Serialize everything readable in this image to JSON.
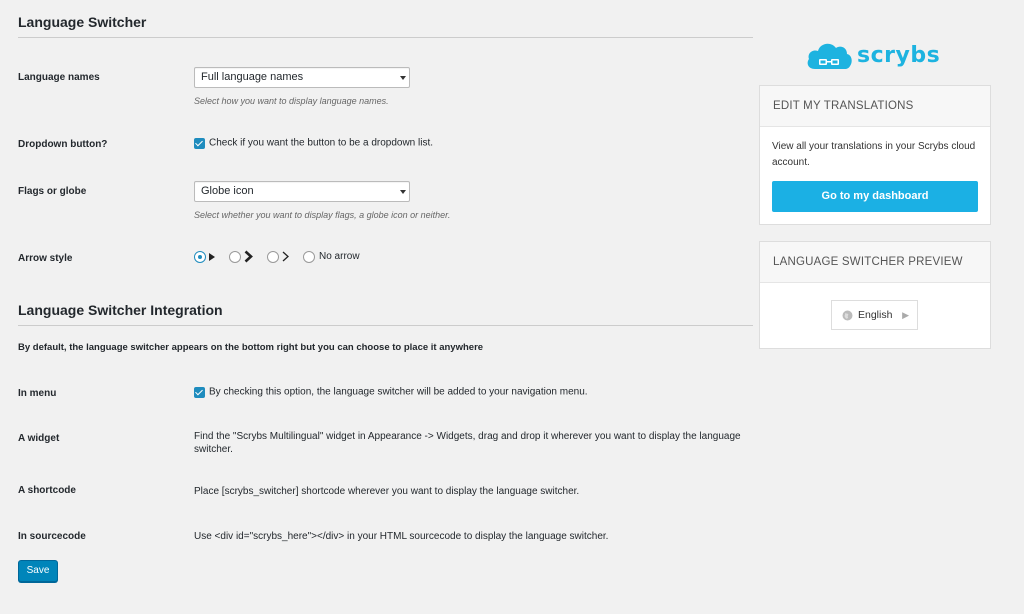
{
  "settings": {
    "title": "Language Switcher",
    "language_names": {
      "label": "Language names",
      "value": "Full language names",
      "description": "Select how you want to display language names."
    },
    "dropdown_button": {
      "label": "Dropdown button?",
      "checkbox_text": "Check if you want the button to be a dropdown list."
    },
    "flags_or_globe": {
      "label": "Flags or globe",
      "value": "Globe icon",
      "description": "Select whether you want to display flags, a globe icon or neither."
    },
    "arrow_style": {
      "label": "Arrow style",
      "no_arrow_label": "No arrow",
      "selected_index": 0
    }
  },
  "integration": {
    "title": "Language Switcher Integration",
    "intro": "By default, the language switcher appears on the bottom right but you can choose to place it anywhere",
    "in_menu": {
      "label": "In menu",
      "checkbox_text": "By checking this option, the language switcher will be added to your navigation menu."
    },
    "widget": {
      "label": "A widget",
      "text": "Find the \"Scrybs Multilingual\" widget in Appearance -> Widgets, drag and drop it wherever you want to display the language switcher."
    },
    "shortcode": {
      "label": "A shortcode",
      "text": "Place [scrybs_switcher] shortcode wherever you want to display the language switcher."
    },
    "sourcecode": {
      "label": "In sourcecode",
      "text": "Use <div id=\"scrybs_here\"></div> in your HTML sourcecode to display the language switcher."
    }
  },
  "save_label": "Save",
  "sidebar": {
    "logo_text": "scrybs",
    "edit_box": {
      "title": "EDIT MY TRANSLATIONS",
      "text": "View all your translations in your Scrybs cloud account.",
      "button": "Go to my dashboard"
    },
    "preview_box": {
      "title": "LANGUAGE SWITCHER PREVIEW",
      "language": "English"
    }
  },
  "colors": {
    "accent": "#1e8cbe",
    "brand": "#1db3e0",
    "save_button": "#0085ba"
  }
}
